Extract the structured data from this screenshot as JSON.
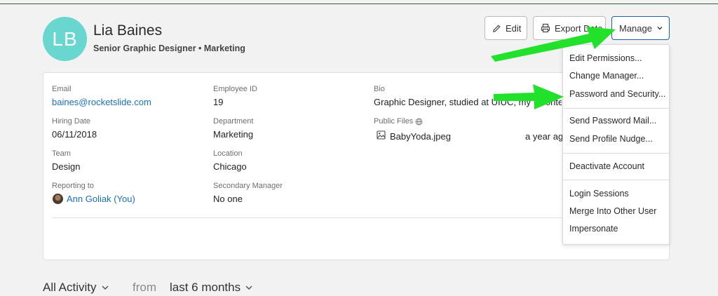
{
  "profile": {
    "initials": "LB",
    "name": "Lia Baines",
    "subtitle": "Senior Graphic Designer • Marketing"
  },
  "toolbar": {
    "edit_label": "Edit",
    "export_label": "Export Data",
    "manage_label": "Manage"
  },
  "fields": {
    "email_label": "Email",
    "email_value": "baines@rocketslide.com",
    "employee_id_label": "Employee ID",
    "employee_id_value": "19",
    "bio_label": "Bio",
    "bio_value": "Graphic Designer, studied at UIUC, my favorite color is",
    "hiring_date_label": "Hiring Date",
    "hiring_date_value": "06/11/2018",
    "department_label": "Department",
    "department_value": "Marketing",
    "public_files_label": "Public Files",
    "file_name": "BabyYoda.jpeg",
    "file_time": "a year ago",
    "team_label": "Team",
    "team_value": "Design",
    "location_label": "Location",
    "location_value": "Chicago",
    "reporting_label": "Reporting to",
    "reporting_value": "Ann Goliak (You)",
    "secondary_manager_label": "Secondary Manager",
    "secondary_manager_value": "No one"
  },
  "manage_menu": {
    "edit_permissions": "Edit Permissions...",
    "change_manager": "Change Manager...",
    "password_security": "Password and Security...",
    "send_password_mail": "Send Password Mail...",
    "send_profile_nudge": "Send Profile Nudge...",
    "deactivate_account": "Deactivate Account",
    "login_sessions": "Login Sessions",
    "merge_user": "Merge Into Other User",
    "impersonate": "Impersonate"
  },
  "activity": {
    "filter_label": "All Activity",
    "from_label": "from",
    "range_label": "last 6 months"
  },
  "colors": {
    "avatar": "#6ad6d0",
    "link": "#1a6fc2",
    "manage_border": "#1f5ea8",
    "annotation_arrow": "#22e12a"
  },
  "icons": {
    "edit": "pencil-icon",
    "export": "printer-icon",
    "manage": "chevron-down-icon",
    "public_files": "globe-icon",
    "file": "image-file-icon"
  }
}
